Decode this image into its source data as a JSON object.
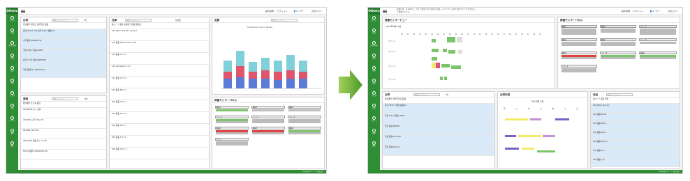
{
  "app": {
    "logo": "Otheta",
    "footer": "Copyright © ** *** 株式会社"
  },
  "header": {
    "help": "操作説明",
    "chat": "💬チャット",
    "user": "👤ユーザー",
    "msg": "お知らせ ▾",
    "sys1": "定休日次 〔12/28日〕 (月) で受注 (月) で受注 (月)は。メンテナンスのためログインできません。",
    "sys2": "ご利用ください。"
  },
  "nav": [
    "ホーム",
    "出荷",
    "生産 計画",
    "調達",
    "在庫",
    "品質",
    "マスタ",
    "分析",
    "レポート",
    "通知",
    "設定"
  ],
  "left": {
    "ship": {
      "title": "出荷",
      "search": "検索キーワード...",
      "total": "5件",
      "rows": [
        "受注番号 受注日 出荷予定 製品",
        "受注 38327 100 出荷 Fabric 製品K22",
        "7件 数量 M00XB1F22",
        "予定 Fabric 製品 L984T",
        "受注 2.5 件 製品 M0XF4E8",
        "予定 製品 M1 T80F5V6 XJ"
      ]
    },
    "proc": {
      "title": "調達",
      "search": "検索キーワード...",
      "total": "12件",
      "rows": [
        "発注番号 仕入先 品目",
        "8830BCFB 仕入 出荷",
        "2018/06 入荷 T-0% ICS",
        "8830BN 2017/5/5",
        "90010650 製品 仕入 77.00",
        "E9301 数量 2019/08/26 WS",
        "2019 発注 工程"
      ]
    },
    "stock": {
      "title": "在庫",
      "search": "検索キーワード...",
      "total": "在庫数",
      "rows": [
        "品コード 品名 在庫数 引当数 発注点",
        "103 Fabric Roll 40 1 pkg 4.0",
        "104 製品 320 120 40 1,204",
        "114 製品 L 4 9 4",
        "115 Cardboard 4 4 9",
        "121 製品 A 4 4 4",
        "134 製品 B 4 6 3",
        "201 製品 C 4 5 2",
        "222 製品 D 4 2 4",
        "223 製品 E 9 4 1",
        "230 製品 F 4 3 9",
        "240 製品 G 4 1 4",
        "330 製品 H 4 4 9"
      ]
    },
    "quality": {
      "title": "品質",
      "search": "検索キーワード",
      "chart_title": "Checksum Chart ·Series"
    },
    "monitor": {
      "title": "稼働モニターパネル",
      "items": [
        "機械1",
        "機械2",
        "機械3",
        "ライン1",
        "ライン2",
        "ライン3",
        "機械4",
        "機械5",
        "機械6",
        "ライン"
      ]
    }
  },
  "right": {
    "gantt": {
      "title": "稼働モニタービュー",
      "date": "2019年3月15日",
      "rows": [
        "ライン1",
        "ライン2",
        "ライン3",
        "ライン4"
      ],
      "hours": [
        "00",
        "01",
        "02",
        "03",
        "04",
        "05",
        "06",
        "07",
        "08",
        "09",
        "10",
        "11",
        "12",
        "13",
        "14",
        "15",
        "16",
        "17",
        "18",
        "19",
        "20",
        "21",
        "22",
        "23"
      ]
    },
    "panel": {
      "title": "稼働モニターパネル",
      "items": [
        "機械1",
        "機械2",
        "ライン1",
        "機械3",
        "機械4",
        "ライン2",
        "機械5",
        "ライン3",
        "機械6",
        "ライン4",
        "ライン5"
      ]
    },
    "ship": {
      "title": "出荷",
      "search": "検索キーワード...",
      "total": "5件",
      "rows": [
        "受注番号 出荷予定日 製品",
        "受注 38327 出荷 製品K22",
        "予定 Fabric 製品 L984T",
        "予定 製品 M00XB",
        "予定 製品 M1 T80F",
        "予定 製品 Normal"
      ]
    },
    "cal": {
      "title": "出荷日程",
      "month": "2019年 3月",
      "days": [
        "月",
        "火",
        "水",
        "木",
        "金",
        "土",
        "日"
      ]
    },
    "goods": {
      "title": "商品",
      "search": "検索キーワード...",
      "rows": [
        "品コード 品名 単位",
        "100 Fabric Roll ptc",
        "101 製品 R8 kg",
        "103 製品 M8 pc",
        "105 製品 M9 pc",
        "106 製品 M12 pc",
        "110 製品 K pc",
        "120 製品 L pc"
      ]
    }
  }
}
